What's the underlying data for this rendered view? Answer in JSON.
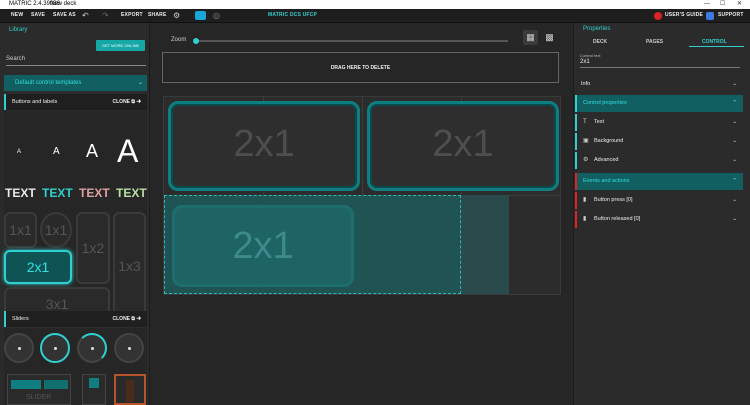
{
  "titlebar": {
    "app": "MATRIC 2.4.39986",
    "deck": "New deck",
    "min": "—",
    "max": "☐",
    "close": "✕"
  },
  "toolbar": {
    "new": "NEW",
    "save": "SAVE",
    "save_as": "SAVE AS",
    "export": "EXPORT",
    "share": "SHARE",
    "deck_title": "MATRIC DCS UFCP",
    "users_guide": "USER'S GUIDE",
    "support": "SUPPORT"
  },
  "library": {
    "title": "Library",
    "get_more": "GET MORE ONLINE",
    "search_placeholder": "Search",
    "templates_label": "Default control templates",
    "buttons_section": "Buttons and labels",
    "clone": "CLONE",
    "aa": [
      "A",
      "A",
      "A",
      "A"
    ],
    "text_samples": [
      {
        "label": "TEXT",
        "color": "#e8e8e8"
      },
      {
        "label": "TEXT",
        "color": "#2fd0cf"
      },
      {
        "label": "TEXT",
        "color": "#e0a0a0"
      },
      {
        "label": "TEXT",
        "color": "#b8e0a0"
      }
    ],
    "buttons": [
      "1x1",
      "1x1",
      "1x2",
      "1x3",
      "2x1",
      "3x1"
    ],
    "sliders_section": "Sliders",
    "slider_label": "SLIDER"
  },
  "canvas": {
    "zoom_label": "Zoom",
    "drag_zone": "DRAG HERE TO DELETE",
    "tiles": [
      "2x1",
      "2x1",
      "2x1"
    ]
  },
  "properties": {
    "title": "Properties",
    "tabs": [
      "DECK",
      "PAGES",
      "CONTROL"
    ],
    "control_text_label": "Control text",
    "control_text_value": "2x1",
    "info": "Info",
    "control_properties": "Control properties",
    "text": "Text",
    "background": "Background",
    "advanced": "Advanced",
    "events": "Events and actions",
    "button_press": "Button press [0]",
    "button_released": "Button released [0]"
  },
  "colors": {
    "accent": "#2fd0cf",
    "accent_dark": "#115f60",
    "tile_border": "#0f7e80"
  }
}
